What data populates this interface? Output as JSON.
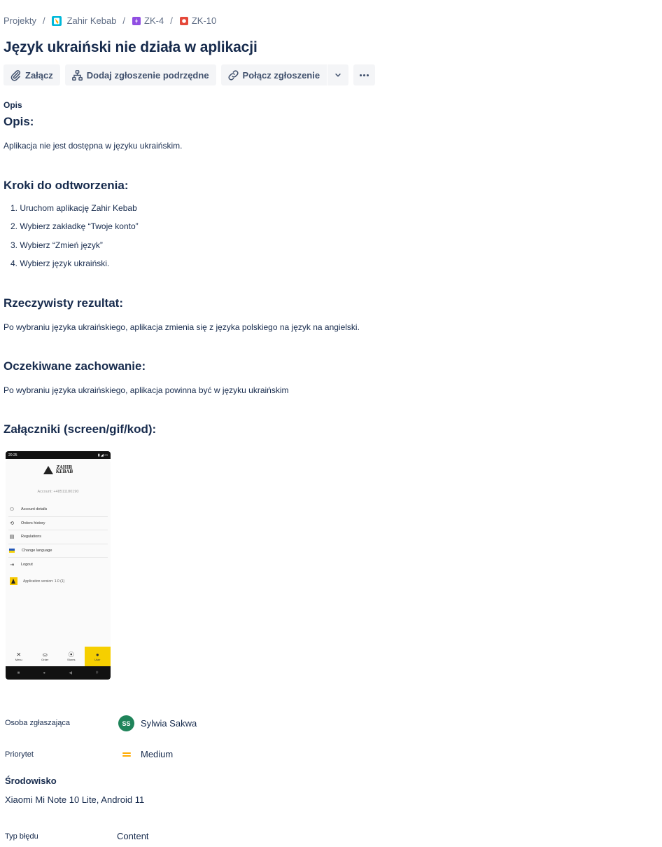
{
  "breadcrumb": {
    "items": [
      {
        "label": "Projekty",
        "icon": null
      },
      {
        "label": "Zahir Kebab",
        "icon": "project-avatar-icon",
        "color": "#00b8d9"
      },
      {
        "label": "ZK-4",
        "icon": "epic-icon",
        "color": "#904ee2"
      },
      {
        "label": "ZK-10",
        "icon": "bug-icon",
        "color": "#e5493a"
      }
    ]
  },
  "issue": {
    "title": "Język ukraiński nie działa w aplikacji"
  },
  "toolbar": {
    "attach_label": "Załącz",
    "add_child_label": "Dodaj zgłoszenie podrzędne",
    "link_label": "Połącz zgłoszenie"
  },
  "description": {
    "section_label": "Opis",
    "h_opis": "Opis:",
    "opis_text": "Aplikacja nie jest dostępna w języku ukraińskim.",
    "h_steps": "Kroki do odtworzenia:",
    "steps": [
      "1. Uruchom aplikację Zahir Kebab",
      "2. Wybierz zakładkę “Twoje konto”",
      "3. Wybierz “Zmień język”",
      "4. Wybierz język ukraiński."
    ],
    "h_actual": "Rzeczywisty rezultat:",
    "actual_text": "Po wybraniu języka ukraińskiego, aplikacja zmienia się z języka polskiego na język na angielski.",
    "h_expected": "Oczekiwane zachowanie:",
    "expected_text": "Po wybraniu języka ukraińskiego, aplikacja powinna być w języku ukraińskim",
    "h_attachments": "Załączniki (screen/gif/kod):"
  },
  "attachment_screen": {
    "status_time": "20:25",
    "brand_line1": "ZAHIR",
    "brand_line2": "KEBAB",
    "account": "Account: +48511180190",
    "menu": [
      {
        "label": "Account details",
        "icon": "user-settings-icon"
      },
      {
        "label": "Orders history",
        "icon": "history-icon"
      },
      {
        "label": "Regulations",
        "icon": "document-icon"
      },
      {
        "label": "Change language",
        "icon": "ukraine-flag-icon"
      },
      {
        "label": "Logout",
        "icon": "logout-icon"
      }
    ],
    "version": "Application version: 1.0 (1)",
    "nav": [
      {
        "label": "Menu",
        "icon": "utensils-icon"
      },
      {
        "label": "Order",
        "icon": "basket-icon"
      },
      {
        "label": "Stores",
        "icon": "pin-icon"
      },
      {
        "label": "User",
        "icon": "user-icon"
      }
    ],
    "active_tab": "User"
  },
  "fields": {
    "reporter_label": "Osoba zgłaszająca",
    "reporter_initials": "SS",
    "reporter_name": "Sylwia Sakwa",
    "priority_label": "Priorytet",
    "priority_value": "Medium",
    "priority_color": "#ffab00",
    "environment_label": "Środowisko",
    "environment_value": "Xiaomi Mi Note 10 Lite, Android 11",
    "bug_type_label": "Typ błędu",
    "bug_type_value": "Content"
  }
}
